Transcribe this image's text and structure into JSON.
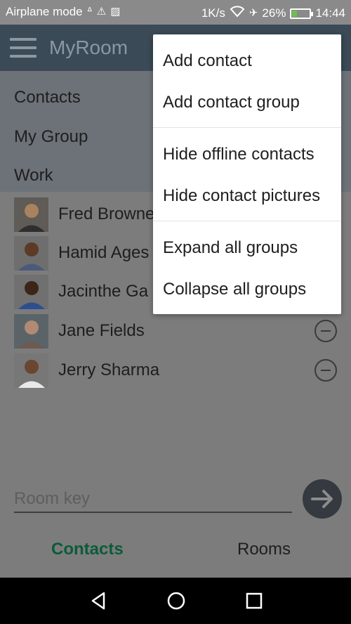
{
  "status_bar": {
    "left_text": "Airplane mode",
    "data_rate": "1K/s",
    "battery_percent": "26%",
    "battery_level": 0.26,
    "time": "14:44",
    "icons": [
      "data-saver-icon",
      "warning-icon",
      "image-icon",
      "wifi-icon",
      "airplane-icon",
      "battery-charging-icon"
    ]
  },
  "app_bar": {
    "title": "MyRoom",
    "menu_icon": "hamburger-icon"
  },
  "groups": [
    "Contacts",
    "My Group",
    "Work"
  ],
  "contacts": [
    {
      "name": "Fred Browne"
    },
    {
      "name": "Hamid Ages"
    },
    {
      "name": "Jacinthe Ga"
    },
    {
      "name": "Jane Fields"
    },
    {
      "name": "Jerry Sharma"
    }
  ],
  "room_key": {
    "placeholder": "Room key",
    "value": ""
  },
  "tabs": {
    "contacts": "Contacts",
    "rooms": "Rooms"
  },
  "menu": {
    "items": [
      "Add contact",
      "Add contact group",
      "Hide offline contacts",
      "Hide contact pictures",
      "Expand all groups",
      "Collapse all groups"
    ]
  },
  "colors": {
    "app_bar": "#3a4a56",
    "active_tab": "#0c5b3b",
    "overlay_background": "#7c7c7c",
    "menu_background": "#ffffff"
  }
}
